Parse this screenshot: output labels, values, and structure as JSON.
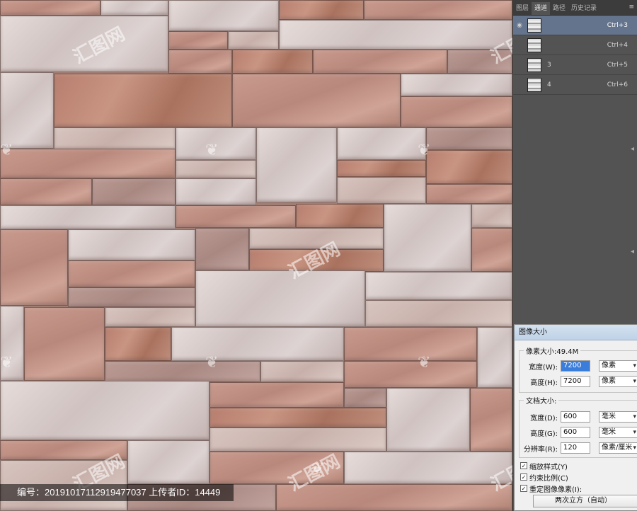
{
  "panel": {
    "tabs": [
      "图层",
      "通道",
      "路径",
      "历史记录"
    ],
    "active_tab": 1,
    "menu_icon": "panel-menu-icon",
    "channels": [
      {
        "name": "",
        "shortcut": "Ctrl+3",
        "selected": true
      },
      {
        "name": "",
        "shortcut": "Ctrl+4",
        "selected": false
      },
      {
        "name": "3",
        "shortcut": "Ctrl+5",
        "selected": false
      },
      {
        "name": "4",
        "shortcut": "Ctrl+6",
        "selected": false
      }
    ]
  },
  "dialog": {
    "title": "图像大小",
    "pixel_dim_label": "像素大小:49.4M",
    "width_label": "宽度(W):",
    "width_value": "7200",
    "width_unit": "像素",
    "height_label": "高度(H):",
    "height_value": "7200",
    "height_unit": "像素",
    "doc_size_label": "文档大小:",
    "doc_width_label": "宽度(D):",
    "doc_width_value": "600",
    "doc_width_unit": "毫米",
    "doc_height_label": "高度(G):",
    "doc_height_value": "600",
    "doc_height_unit": "毫米",
    "resolution_label": "分辨率(R):",
    "resolution_value": "120",
    "resolution_unit": "像素/厘米",
    "scale_styles": "缩放样式(Y)",
    "constrain": "约束比例(C)",
    "resample": "重定图像像素(I):",
    "resample_method": "两次立方（自动）"
  },
  "watermark": {
    "text": "汇图网",
    "caption": "编号：20191017112919477037 上传者ID：14449"
  },
  "colors": {
    "panel_bg": "#535353",
    "selected_row": "#64748c",
    "dialog_bg": "#f0f0f0"
  }
}
